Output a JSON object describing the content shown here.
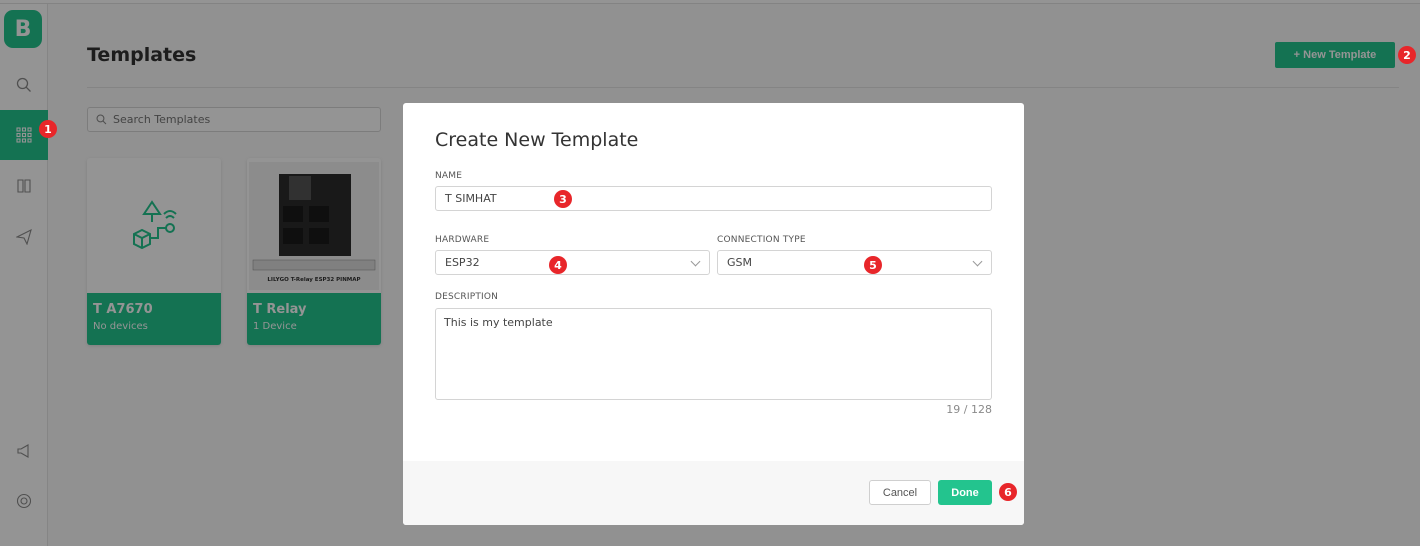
{
  "sidebar": {
    "logo": "B",
    "items": [
      {
        "name": "search",
        "glyph": "⚲"
      },
      {
        "name": "templates",
        "glyph": "▦"
      },
      {
        "name": "docs",
        "glyph": "◫"
      },
      {
        "name": "send",
        "glyph": "➤"
      },
      {
        "name": "announce",
        "glyph": "📣"
      },
      {
        "name": "help",
        "glyph": "◎"
      }
    ]
  },
  "page": {
    "title": "Templates",
    "new_button": "+ New Template",
    "search_placeholder": "Search Templates"
  },
  "cards": [
    {
      "title": "T A7670",
      "subtitle": "No devices"
    },
    {
      "title": "T Relay",
      "subtitle": "1 Device",
      "image_caption": "LILYGO T-Relay ESP32 PINMAP"
    }
  ],
  "modal": {
    "title": "Create New Template",
    "name_label": "NAME",
    "name_value": "T SIMHAT",
    "hardware_label": "HARDWARE",
    "hardware_value": "ESP32",
    "connection_label": "CONNECTION TYPE",
    "connection_value": "GSM",
    "description_label": "DESCRIPTION",
    "description_value": "This is my template",
    "counter": "19 / 128",
    "cancel": "Cancel",
    "done": "Done"
  },
  "markers": [
    "1",
    "2",
    "3",
    "4",
    "5",
    "6"
  ],
  "colors": {
    "accent": "#23c48e",
    "marker": "#e8262a"
  }
}
